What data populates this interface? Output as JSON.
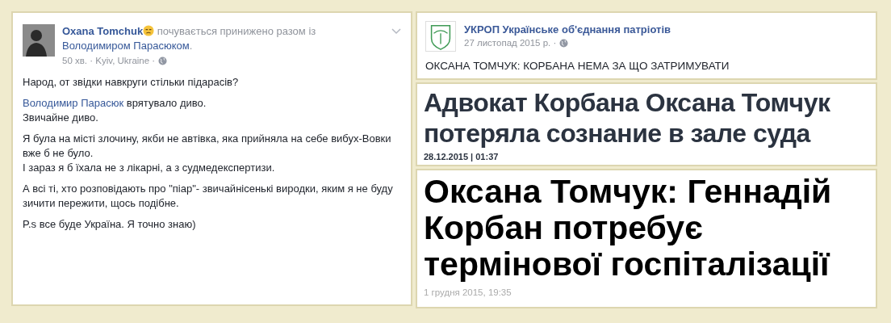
{
  "facebook_post": {
    "author": "Oxana Tomchuk",
    "feeling": "почувається принижено разом із",
    "tagged": "Володимиром Парасюком",
    "tagged_suffix": ".",
    "meta": "50 хв. · Kyiv, Ukraine ·",
    "paragraphs": [
      {
        "text": "Народ, от звідки навкруги стільки підарасів?"
      },
      {
        "link": "Володимир Парасюк",
        "text": " врятувало диво.\nЗвичайне диво."
      },
      {
        "text": "Я була на місті злочину, якби не автівка, яка прийняла на себе вибух-Вовки вже б не було.\nІ зараз я б їхала не з лікарні, а з судмедекспертизи."
      },
      {
        "text": "А всі ті, хто розповідають про \"піар\"- звичайнісенькі виродки, яким я не буду зичити пережити, щось подібне."
      },
      {
        "text": "P.s все буде Україна. Я точно знаю)"
      }
    ]
  },
  "page_post": {
    "page_name": "УКРОП Українське об'єднання патріотів",
    "meta": "27 листопад 2015 р. ·",
    "text": "ОКСАНА ТОМЧУК: КОРБАНА НЕМА ЗА ЩО ЗАТРИМУВАТИ"
  },
  "news": [
    {
      "kind": "condensed",
      "headline": "Адвокат Корбана Оксана Томчук потеряла сознание в зале суда",
      "date": "28.12.2015 | 01:37"
    },
    {
      "kind": "heavy",
      "headline": "Оксана Томчук: Геннадій Корбан потребує термінової госпіталізації",
      "date": "1 грудня 2015, 19:35"
    }
  ]
}
